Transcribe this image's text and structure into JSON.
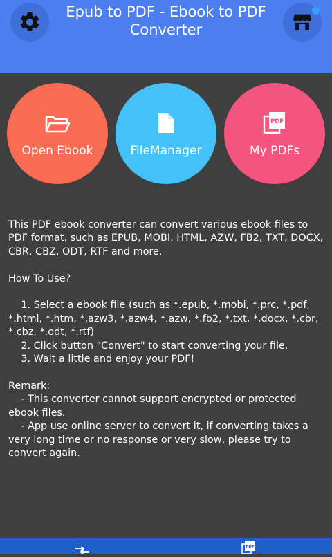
{
  "header": {
    "title": "Epub to PDF - Ebook to PDF Converter",
    "settings_icon": "gear-icon",
    "store_icon": "store-icon"
  },
  "actions": [
    {
      "label": "Open Ebook",
      "icon": "folder-open-icon",
      "color": "#f96b53"
    },
    {
      "label": "FileManager",
      "icon": "file-icon",
      "color": "#45c1f7"
    },
    {
      "label": "My PDFs",
      "icon": "pdf-icon",
      "color": "#f5547f"
    }
  ],
  "content": {
    "description": "This PDF ebook converter can convert various ebook files to PDF format, such as EPUB, MOBI, HTML, AZW, FB2, TXT, DOCX, CBR, CBZ, ODT, RTF and more.",
    "how_to_heading": "How To Use?",
    "step1": "    1. Select a ebook file (such as *.epub, *.mobi, *.prc, *.pdf, *.html, *.htm, *.azw3, *.azw4, *.azw, *.fb2, *.txt, *.docx, *.cbr, *.cbz, *.odt, *.rtf)",
    "step2": "    2. Click button \"Convert\" to start converting your file.",
    "step3": "    3. Wait a little and enjoy your PDF!",
    "remark_heading": "Remark:",
    "remark1": "    - This converter cannot support encrypted or protected ebook files.",
    "remark2": "    - App use online server to convert it, if converting takes a very long time or no response or very slow, please try to convert again."
  },
  "bottom_nav": [
    {
      "icon": "convert-arrows-icon"
    },
    {
      "icon": "pdf-icon"
    }
  ],
  "colors": {
    "header": "#4c7ef0",
    "background": "#3f3f3f",
    "bottom_bar": "#1e5fc8"
  }
}
